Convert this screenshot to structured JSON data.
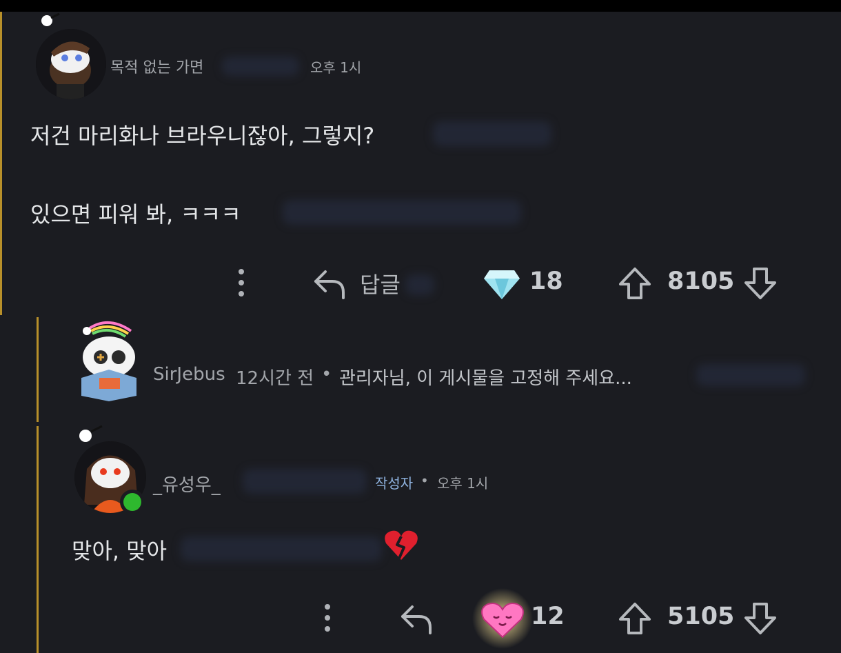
{
  "comments": [
    {
      "author": "목적 없는 가면",
      "time": "오후 1시",
      "lines": [
        "저건 마리화나 브라우니잖아, 그렇지?",
        "있으면 피워 봐, ㅋㅋㅋ"
      ],
      "actions": {
        "reply_label": "답글",
        "award_count": "18",
        "score": "8105"
      }
    },
    {
      "collapsed_author": "SirJebus",
      "collapsed_time": "12시간 전",
      "collapsed_separator": "•",
      "collapsed_preview": "관리자님, 이 게시물을 고정해 주세요..."
    },
    {
      "author": "_유성우_",
      "badge": "작성자",
      "separator": "•",
      "time": "오후 1시",
      "lines": [
        "맞아, 맞아"
      ],
      "actions": {
        "award_count": "12",
        "score": "5105"
      }
    }
  ],
  "icons": {
    "more": "more-vertical-icon",
    "reply": "reply-arrow-icon",
    "award1": "diamond-award-icon",
    "award2": "heart-award-icon",
    "upvote": "upvote-arrow-icon",
    "downvote": "downvote-arrow-icon",
    "emoji": "broken-heart-emoji"
  },
  "colors": {
    "background": "#1b1c21",
    "thread_line": "#b8902a",
    "badge": "#8fb3e0",
    "online": "#2eb82e"
  }
}
